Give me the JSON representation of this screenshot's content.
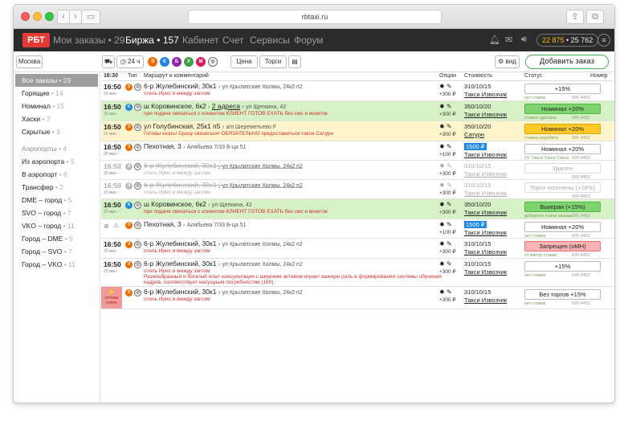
{
  "browser": {
    "url": "rbtaxi.ru"
  },
  "nav": {
    "logo": "РБТ",
    "my_orders": "Мои заказы • 29",
    "exchange": "Биржа • 157",
    "cabinet": "Кабинет",
    "account": "Счет",
    "services": "Сервисы",
    "forum": "Форум",
    "balance_main": "22 875",
    "balance_rest": " • 25 762"
  },
  "toolbar": {
    "city": "Москва",
    "hours": "24 ч",
    "classes": [
      "Э",
      "К",
      "Б",
      "У",
      "М"
    ],
    "price_filter": "Цена",
    "auction_filter": "Торги",
    "view": "вид",
    "add_order": "Добавить заказ"
  },
  "sidebar": {
    "items": [
      {
        "label": "Все заказы",
        "count": " • 29",
        "active": true
      },
      {
        "label": "Горящие",
        "count": " • 14"
      },
      {
        "label": "Номинал",
        "count": " • 15"
      },
      {
        "label": "Хаски",
        "count": " • 7"
      },
      {
        "label": "Скрытые",
        "count": " • 3"
      }
    ],
    "airports_head": "Аэропорты",
    "airports_count": " • 4",
    "airport_items": [
      {
        "label": "Из аэропорта",
        "count": " • 5"
      },
      {
        "label": "В аэропорт",
        "count": " • 6"
      },
      {
        "label": "Трансфер",
        "count": " • 2"
      },
      {
        "label": "DME – город",
        "count": " • 5"
      },
      {
        "label": "SVO – город",
        "count": " • 7"
      },
      {
        "label": "VKO – город",
        "count": " • 11"
      },
      {
        "label": "Город – DME",
        "count": " • 5"
      },
      {
        "label": "Город – SVO",
        "count": " • 7"
      },
      {
        "label": "Город – VKO",
        "count": " • 11"
      }
    ]
  },
  "table": {
    "headers": {
      "time": "16:30",
      "type": "Тип",
      "route": "Маршрут и комментарий",
      "options": "Опции",
      "cost": "Стоимость",
      "status": "Статус",
      "number": "Номер"
    },
    "rows": [
      {
        "time": "16:50",
        "mins": "20 мин",
        "cls": "Э",
        "from": "6-р Жулебинский, 30к1",
        "to": "ул Крылатские Холмы, 24к2 п2",
        "comment": "отель Ирис и между загсом",
        "opt": "+300 ₽",
        "cost": "310/10/15",
        "company": "Такси Извозчик",
        "status": "+15%",
        "note": "нет ставок",
        "num": "695 4452"
      },
      {
        "time": "16:50",
        "mins": "20 мин",
        "cls": "К",
        "from": "ш Коровинское, 6к2",
        "mid": "2 адреса",
        "to": "ул Щепкина, 42",
        "comment": "при подаче связаться с клиентом КЛИЕНТ ГОТОВ ЕХАТЬ без смс и визиток",
        "opt": "+300 ₽",
        "cost": "350/10/20",
        "company": "Такси Извозчик",
        "status": "Номинал +20%",
        "note": "ставка сделана",
        "num": "695 4452"
      },
      {
        "time": "16:50",
        "mins": "20 мин",
        "cls": "Э",
        "from": "ул Голубинская, 25к1 п5",
        "to": "а/п Шереметьево F",
        "comment": "Готовы ехать! Сразу связаться! ОБЯЗАТЕЛЬНО предоставиться такси Сатурн",
        "opt": "+300 ₽",
        "cost": "350/10/20",
        "company": "Сатурн",
        "status": "Номинал +20%",
        "note": "ставка перебита",
        "num": "695 4452"
      },
      {
        "time": "16:50",
        "mins": "20 мин",
        "cls": "Э",
        "from": "Пехотная, 3",
        "to": "Алябьева 7/33 Б-ца 51",
        "comment": "",
        "opt": "+100 ₽",
        "cost": "1500 ₽",
        "company": "Такси Извозчик",
        "status": "Номинал +20%",
        "note": "От Такси Такси Такси",
        "num": "695 4452"
      },
      {
        "time": "16:50",
        "mins": "20 мин",
        "cls": "Э",
        "from": "6-р Жулебинский, 30к1",
        "to": "ул Крылатские Холмы, 24к2 п2",
        "comment": "отель Ирис и между загсом",
        "opt": "+300 ₽",
        "cost": "310/10/15",
        "company": "Такси Извозчик",
        "status": "Удален",
        "note": "",
        "num": "695 4452"
      },
      {
        "time": "16:50",
        "mins": "20 мин",
        "cls": "Э",
        "from": "6-р Жулебинский, 30к1",
        "to": "ул Крылатские Холмы, 24к2 п2",
        "comment": "отель Ирис и между загсом",
        "opt": "+300 ₽",
        "cost": "310/10/15",
        "company": "Такси Извозчик",
        "status": "Торги окончены (+18%)",
        "note": "",
        "num": "695 4452"
      },
      {
        "time": "16:50",
        "mins": "20 мин",
        "cls": "К",
        "from": "ш Коровинское, 6к2",
        "to": "ул Щепкина, 42",
        "comment": "при подаче связаться с клиентом КЛИЕНТ ГОТОВ ЕХАТЬ без смс и визиток",
        "opt": "+300 ₽",
        "cost": "350/10/20",
        "company": "Такси Извозчик",
        "status": "Выигран (+15%)",
        "note": "добавлен в мои заказы",
        "num": "695 4452"
      },
      {
        "time": "",
        "mins": "",
        "cls": "Э",
        "from": "Пехотная, 3",
        "to": "Алябьева 7/33 Б-ца 51",
        "comment": "",
        "opt": "+100 ₽",
        "cost": "1500 ₽",
        "company": "Такси Извозчик",
        "status": "Номинал +20%",
        "note": "нет ставок",
        "num": "695 4452"
      },
      {
        "time": "16:50",
        "mins": "20 мин",
        "cls": "Э",
        "from": "6-р Жулебинский, 30к1",
        "to": "ул Крылатские Холмы, 24к2 п2",
        "comment": "отель Ирис и между загсом",
        "opt": "+300 ₽",
        "cost": "310/10/15",
        "company": "Такси Извозчик",
        "status": "Запрещен (оМН)",
        "note": "от Автор ставки",
        "num": "695 4452"
      },
      {
        "time": "16:50",
        "mins": "20 мин",
        "cls": "Э",
        "from": "6-р Жулебинский, 30к1",
        "to": "ул Крылатские Холмы, 24к2 п2",
        "comment": "отель Ирис и между загсом",
        "comment2": "Разнообразный и богатый опыт консультация с широким активом играет важную роль в формировании системы обучения",
        "comment3": "кадров, соответствует насущным потребностям (160)",
        "opt": "+300 ₽",
        "cost": "310/10/15",
        "company": "Такси Извозчик",
        "status": "+15%",
        "note": "нет ставок",
        "num": "695 4452"
      },
      {
        "time": "",
        "mins": "",
        "ready": "готовы ехать",
        "cls": "Э",
        "from": "6-р Жулебинский, 30к1",
        "to": "ул Крылатские Холмы, 24к2 п2",
        "comment": "отель Ирис и между загсом",
        "opt": "+300 ₽",
        "cost": "310/10/15",
        "company": "Такси Извозчик",
        "status": "Без торгов +15%",
        "note": "нет ставок",
        "num": "695 4452"
      }
    ]
  },
  "colors": {
    "accent_red": "#e53935",
    "green_row": "#d5f1c5",
    "yellow_row": "#fff5cc",
    "balance": "#ffb300"
  }
}
